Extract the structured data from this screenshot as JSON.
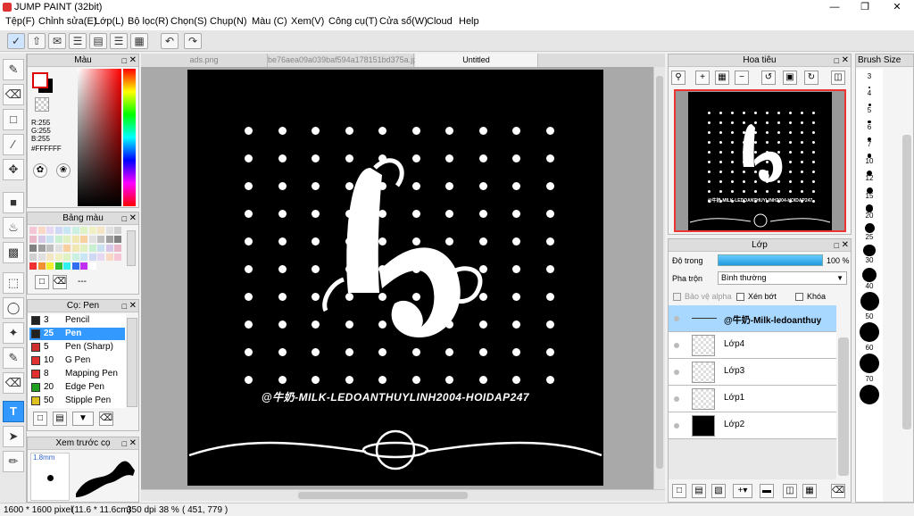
{
  "app": {
    "title": "JUMP PAINT (32bit)"
  },
  "menu": [
    "Tệp(F)",
    "Chỉnh sửa(E)",
    "Lớp(L)",
    "Bộ lọc(R)",
    "Chọn(S)",
    "Chụp(N)",
    "Màu (C)",
    "Xem(V)",
    "Công cụ(T)",
    "Cửa sổ(W)",
    "Cloud",
    "Help"
  ],
  "tabs": [
    "ads.png",
    "be76aea09a039baf594a178151bd375a.jpg",
    "Untitled"
  ],
  "color_panel": {
    "title": "Màu",
    "r": "R:255",
    "g": "G:255",
    "b": "B:255",
    "hex": "#FFFFFF"
  },
  "palette_panel": {
    "title": "Bảng màu",
    "dash": "---"
  },
  "brush_panel": {
    "title": "Cọ: Pen",
    "items": [
      {
        "size": "3",
        "name": "Pencil",
        "color": "#222222"
      },
      {
        "size": "25",
        "name": "Pen",
        "color": "#222222"
      },
      {
        "size": "5",
        "name": "Pen (Sharp)",
        "color": "#d03030"
      },
      {
        "size": "10",
        "name": "G Pen",
        "color": "#e03030"
      },
      {
        "size": "8",
        "name": "Mapping Pen",
        "color": "#e03030"
      },
      {
        "size": "20",
        "name": "Edge Pen",
        "color": "#20a020"
      },
      {
        "size": "50",
        "name": "Stipple Pen",
        "color": "#e0c020"
      }
    ]
  },
  "preview_panel": {
    "title": "Xem trước cọ",
    "size": "1.8mm"
  },
  "artwork": {
    "watermark": "@牛奶-MILK-LEDOANTHUYLINH2004-HOIDAP247",
    "glyph": "h"
  },
  "navigator": {
    "title": "Hoa tiêu",
    "watermark": "@牛奶-MILK-LEDOANTHUYLINH2004-HOIDAP247"
  },
  "layers_panel": {
    "title": "Lớp",
    "opacity_label": "Độ trong",
    "opacity_value": "100 %",
    "opacity": 1.0,
    "blend_label": "Pha trộn",
    "blend_value": "Bình thường",
    "protect_alpha": "Bảo vệ alpha",
    "clip": "Xén bớt",
    "lock": "Khóa",
    "layers": [
      {
        "name": "@牛奶-Milk-ledoanthuy",
        "selected": true
      },
      {
        "name": "Lớp4"
      },
      {
        "name": "Lớp3"
      },
      {
        "name": "Lớp1"
      },
      {
        "name": "Lớp2"
      }
    ]
  },
  "brush_size_panel": {
    "title": "Brush Size",
    "sizes": [
      "3",
      "4",
      "5",
      "6",
      "7",
      "10",
      "12",
      "15",
      "20",
      "25",
      "30",
      "40",
      "50",
      "60",
      "70"
    ]
  },
  "status": {
    "dims": "1600 * 1600 pixel",
    "cm": "(11.6 * 11.6cm)",
    "dpi": "350 dpi",
    "zoom": "38 %",
    "coords": "( 451, 779 )"
  }
}
